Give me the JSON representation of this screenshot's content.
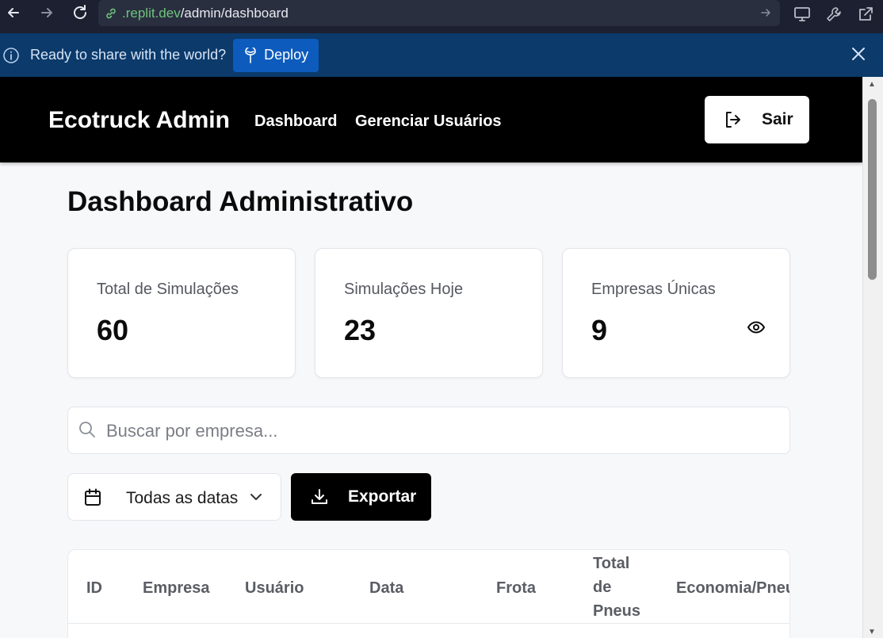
{
  "browser": {
    "url_host": ".replit.dev",
    "url_path": "/admin/dashboard"
  },
  "banner": {
    "message": "Ready to share with the world?",
    "deploy_label": "Deploy"
  },
  "header": {
    "brand": "Ecotruck Admin",
    "nav": [
      "Dashboard",
      "Gerenciar Usuários"
    ],
    "logout_label": "Sair"
  },
  "page": {
    "title": "Dashboard Administrativo"
  },
  "stats": [
    {
      "label": "Total de Simulações",
      "value": "60"
    },
    {
      "label": "Simulações Hoje",
      "value": "23"
    },
    {
      "label": "Empresas Únicas",
      "value": "9"
    }
  ],
  "search": {
    "placeholder": "Buscar por empresa..."
  },
  "filters": {
    "date_selected": "Todas as datas",
    "export_label": "Exportar"
  },
  "table": {
    "columns": [
      "ID",
      "Empresa",
      "Usuário",
      "Data",
      "Frota",
      "Total",
      "de",
      "Pneus",
      "Economia/Pneu"
    ]
  },
  "icons": {
    "back": "arrow-left-icon",
    "forward": "arrow-right-icon",
    "reload": "reload-icon",
    "link": "link-icon",
    "info": "info-icon",
    "deploy": "deploy-icon",
    "close": "close-icon",
    "logout": "logout-icon",
    "eye": "eye-icon",
    "search": "search-icon",
    "calendar": "calendar-icon",
    "chevron": "chevron-down-icon",
    "download": "download-icon"
  },
  "colors": {
    "header_bg": "#000000",
    "banner_bg": "#0b3a6b",
    "deploy_btn": "#0d5bbd",
    "page_bg": "#f7f8fa"
  }
}
